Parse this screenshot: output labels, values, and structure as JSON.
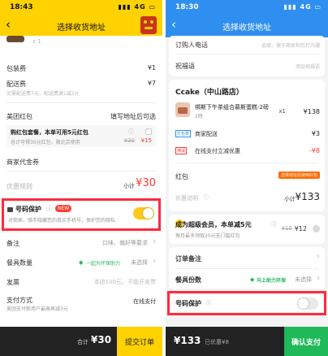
{
  "left": {
    "status_time": "18:43",
    "status_signal": "4G",
    "nav_title": "选择收货地址",
    "item_qty": "x 1",
    "packaging": {
      "label": "包装费",
      "value": "¥1"
    },
    "delivery": {
      "label": "配送费",
      "value": "¥7",
      "note": "另需配送费7元，配送费满1减2元"
    },
    "meituan_coupon": {
      "label": "美团红包",
      "hint": "填写地址后可选"
    },
    "coupon_pack": {
      "label": "购红包套餐，本单可用5元红包",
      "info": "ⓘ",
      "desc": "总计可得30元红包，限北京使用",
      "orig": "¥30",
      "price": "¥15"
    },
    "merchant_coupon": {
      "label": "商家代金券"
    },
    "discount": {
      "label": "优惠规则",
      "subtotal_label": "小计",
      "subtotal": "¥30"
    },
    "privacy": {
      "label": "号码保护",
      "info": "ⓘ",
      "badge": "NEW",
      "desc": "对商家、骑手隐藏您的真实手机号，保护您的隐私"
    },
    "remark": {
      "label": "备注",
      "hint": "口味、偏好等要求",
      "chevron": "›"
    },
    "tableware": {
      "label": "餐具数量",
      "eco": "一起为环保助力",
      "hint": "未选择",
      "chevron": "›"
    },
    "invoice": {
      "label": "发票",
      "hint": "本店100元，不能开发票"
    },
    "payment": {
      "label": "支付方式",
      "sub": "美团支付新用户最高再减3元",
      "value": "在线支付"
    },
    "bottom": {
      "total_label": "合计",
      "total": "¥30",
      "submit": "提交订单"
    }
  },
  "right": {
    "status_time": "18:30",
    "status_signal": "4G",
    "nav_title": "选择收货地址",
    "phone": {
      "label": "订购人电话",
      "hint": "选填，便于商家和您打沟通"
    },
    "blessing": {
      "label": "祝福语",
      "hint": "添加祝福语"
    },
    "shop_name": "Ccake（中山路店）",
    "product": {
      "name": "绑斯下午茶组合慕斯蛋糕-2磅",
      "spec": "2磅",
      "qty": "x1",
      "price": "¥138"
    },
    "packing": {
      "tag": "打包费",
      "label": "商家配送",
      "value": "¥3"
    },
    "online_discount": {
      "tag": "满减",
      "label": "在线支付立减优惠",
      "value": "-¥8"
    },
    "redpacket": {
      "label": "红包",
      "badge": "选择地址后使用红包"
    },
    "discount": {
      "label": "优惠说明",
      "info": "ⓘ",
      "subtotal_label": "小计",
      "subtotal": "¥133"
    },
    "member": {
      "label": "成为超级会员，本单减5元",
      "info": "ⓘ",
      "desc": "每月最多领取20元无门槛红包",
      "orig": "¥15",
      "price": "¥12"
    },
    "remark": {
      "label": "订单备注",
      "chevron": "›"
    },
    "tableware": {
      "label": "餐具份数",
      "eco": "马上助力环保",
      "hint": "未选择",
      "chevron": "›"
    },
    "privacy": {
      "label": "号码保护",
      "info": "ⓘ"
    },
    "bottom": {
      "total": "¥133",
      "saved": "已优惠¥8",
      "submit": "确认支付"
    }
  },
  "colors": {
    "yellow": "#ffd200",
    "blue": "#2f8ff0",
    "green": "#1fb95a",
    "red": "#ff3b30",
    "highlight": "#ff2a3e"
  },
  "toggles": {
    "left_privacy_on": true,
    "right_privacy_on": false
  }
}
